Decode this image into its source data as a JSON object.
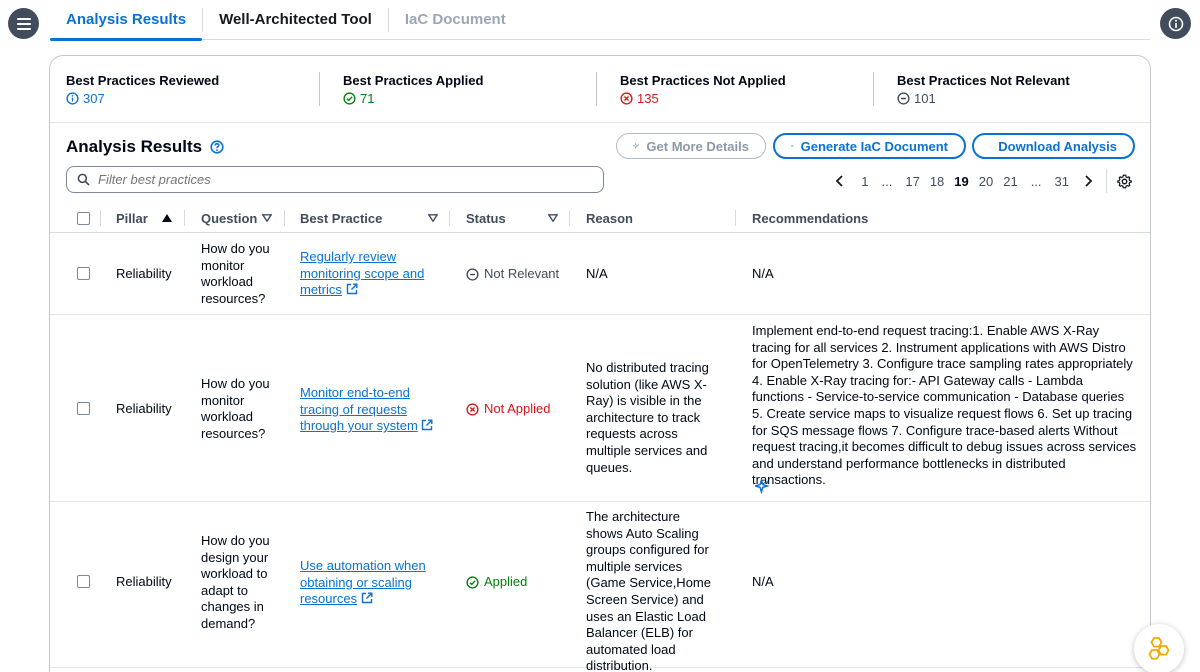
{
  "tabs": [
    {
      "label": "Analysis Results",
      "state": "active"
    },
    {
      "label": "Well-Architected Tool",
      "state": "normal"
    },
    {
      "label": "IaC Document",
      "state": "disabled"
    }
  ],
  "summary": {
    "reviewed": {
      "title": "Best Practices Reviewed",
      "value": "307"
    },
    "applied": {
      "title": "Best Practices Applied",
      "value": "71"
    },
    "not_applied": {
      "title": "Best Practices Not Applied",
      "value": "135"
    },
    "not_relevant": {
      "title": "Best Practices Not Relevant",
      "value": "101"
    }
  },
  "results": {
    "title": "Analysis Results",
    "get_details_label": "Get More Details",
    "generate_label": "Generate IaC Document",
    "download_label": "Download Analysis",
    "filter_placeholder": "Filter best practices"
  },
  "pagination": {
    "pages": [
      "1",
      "...",
      "17",
      "18",
      "19",
      "20",
      "21",
      "...",
      "31"
    ],
    "current": "19"
  },
  "columns": {
    "pillar": "Pillar",
    "question": "Question",
    "best_practice": "Best Practice",
    "status": "Status",
    "reason": "Reason",
    "recommendations": "Recommendations"
  },
  "rows": [
    {
      "pillar": "Reliability",
      "question": "How do you monitor workload resources?",
      "best_practice": "Regularly review monitoring scope and metrics",
      "status": "Not Relevant",
      "reason": "N/A",
      "recommendations": "N/A"
    },
    {
      "pillar": "Reliability",
      "question": "How do you monitor workload resources?",
      "best_practice": "Monitor end-to-end tracing of requests through your system",
      "status": "Not Applied",
      "reason": "No distributed tracing solution (like AWS X-Ray) is visible in the architecture to track requests across multiple services and queues.",
      "recommendations": "Implement end-to-end request tracing:1. Enable AWS X-Ray tracing for all services 2. Instrument applications with AWS Distro for OpenTelemetry 3. Configure trace sampling rates appropriately 4. Enable X-Ray tracing for:- API Gateway calls - Lambda functions - Service-to-service communication - Database queries 5. Create service maps to visualize request flows 6. Set up tracing for SQS message flows 7. Configure trace-based alerts Without request tracing,it becomes difficult to debug issues across services and understand performance bottlenecks in distributed transactions."
    },
    {
      "pillar": "Reliability",
      "question": "How do you design your workload to adapt to changes in demand?",
      "best_practice": "Use automation when obtaining or scaling resources",
      "status": "Applied",
      "reason": "The architecture shows Auto Scaling groups configured for multiple services (Game Service,Home Screen Service) and uses an Elastic Load Balancer (ELB) for automated load distribution.",
      "recommendations": "N/A"
    }
  ],
  "colors": {
    "accent": "#0972d3",
    "applied": "#037f0c",
    "not_applied": "#d91515",
    "neutral": "#414d5c"
  }
}
